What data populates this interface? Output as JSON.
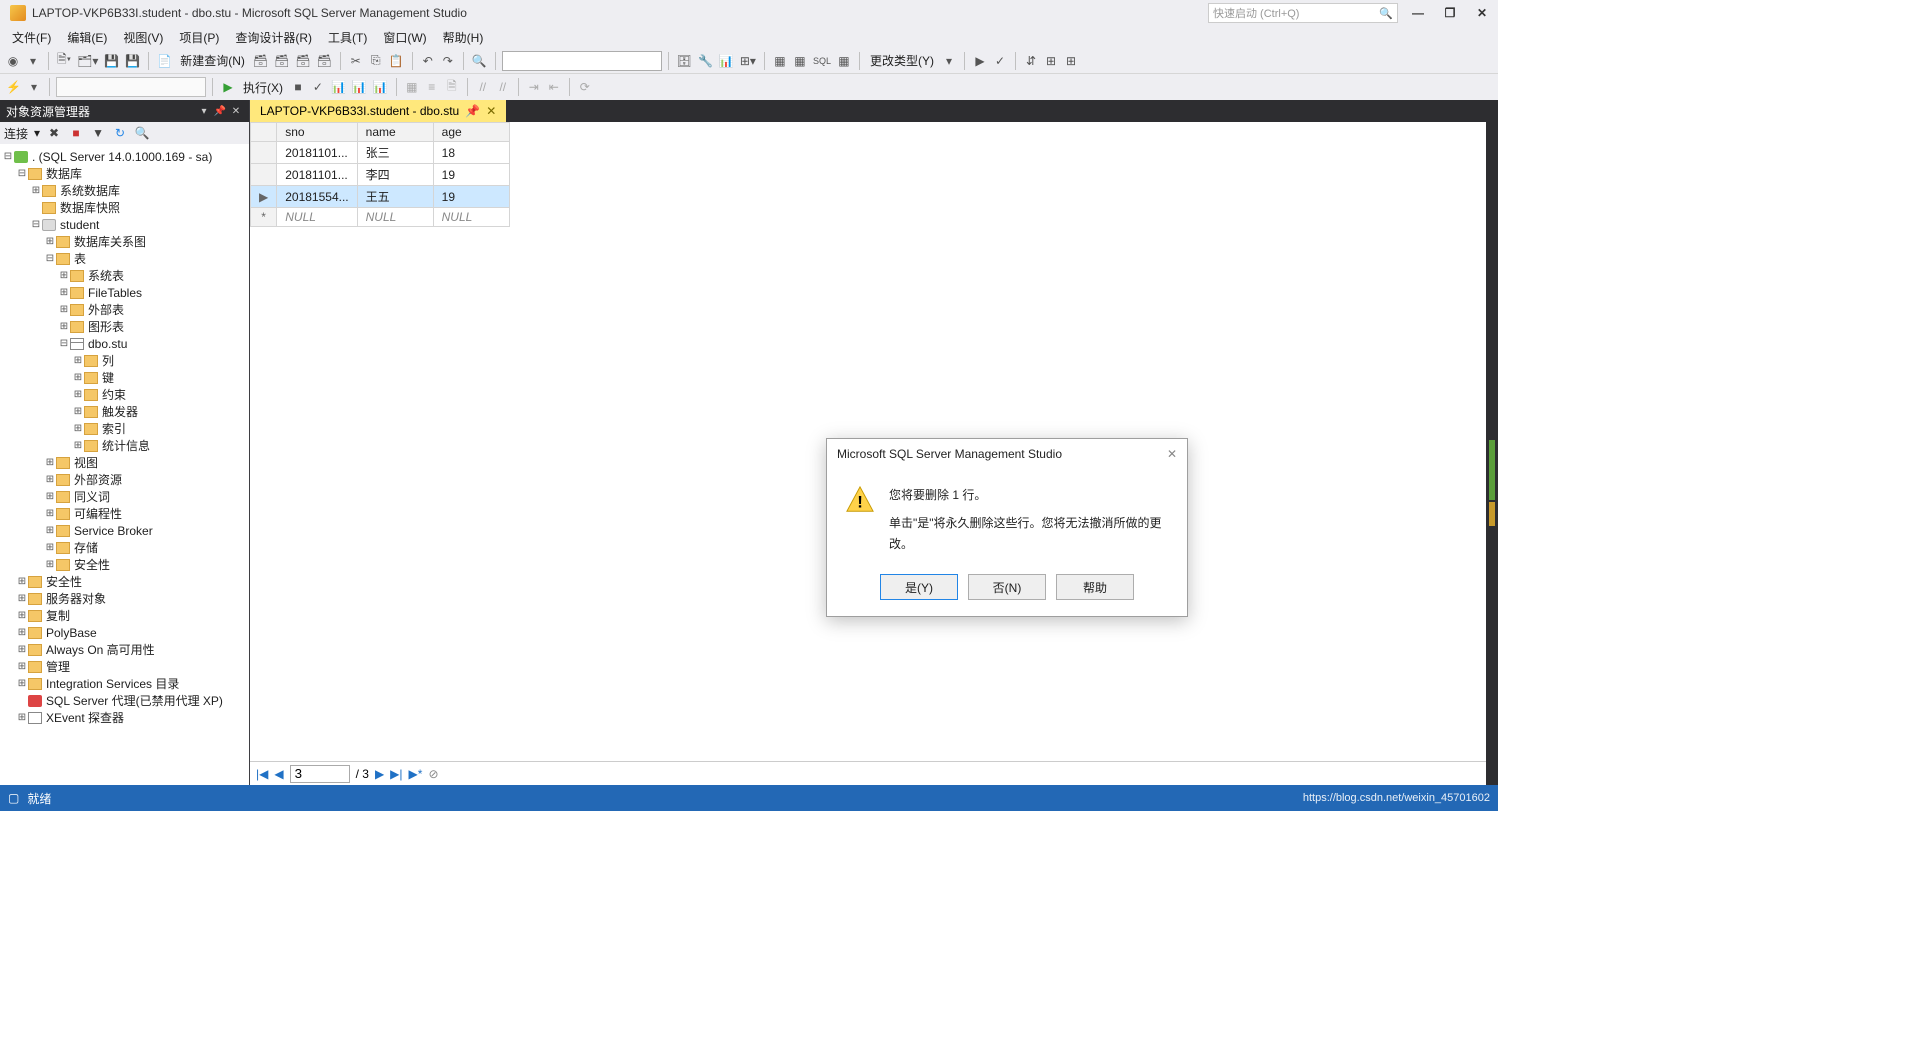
{
  "title": "LAPTOP-VKP6B33I.student - dbo.stu - Microsoft SQL Server Management Studio",
  "quicklaunch_placeholder": "快速启动 (Ctrl+Q)",
  "menus": [
    "文件(F)",
    "编辑(E)",
    "视图(V)",
    "项目(P)",
    "查询设计器(R)",
    "工具(T)",
    "窗口(W)",
    "帮助(H)"
  ],
  "toolbar": {
    "new_query": "新建查询(N)",
    "execute": "执行(X)",
    "change_type": "更改类型(Y)"
  },
  "object_explorer": {
    "title": "对象资源管理器",
    "connect": "连接",
    "root": ". (SQL Server 14.0.1000.169 - sa)",
    "nodes": {
      "databases": "数据库",
      "sys_db": "系统数据库",
      "db_snapshot": "数据库快照",
      "student": "student",
      "db_diagram": "数据库关系图",
      "tables": "表",
      "sys_tables": "系统表",
      "filetables": "FileTables",
      "external_tables": "外部表",
      "graph_tables": "图形表",
      "dbo_stu": "dbo.stu",
      "columns": "列",
      "keys": "键",
      "constraints": "约束",
      "triggers": "触发器",
      "indexes": "索引",
      "statistics": "统计信息",
      "views": "视图",
      "external_res": "外部资源",
      "synonyms": "同义词",
      "programmability": "可编程性",
      "service_broker": "Service Broker",
      "storage": "存储",
      "security_db": "安全性",
      "security": "安全性",
      "server_objects": "服务器对象",
      "replication": "复制",
      "polybase": "PolyBase",
      "always_on": "Always On 高可用性",
      "management": "管理",
      "integration": "Integration Services 目录",
      "sql_agent": "SQL Server 代理(已禁用代理 XP)",
      "xevent": "XEvent 探查器"
    }
  },
  "tab": {
    "label": "LAPTOP-VKP6B33I.student - dbo.stu"
  },
  "grid": {
    "headers": [
      "sno",
      "name",
      "age"
    ],
    "rows": [
      {
        "sno": "20181101...",
        "name": "张三",
        "age": "18"
      },
      {
        "sno": "20181101...",
        "name": "李四",
        "age": "19"
      },
      {
        "sno": "20181554...",
        "name": "王五",
        "age": "19",
        "selected": true
      },
      {
        "sno": "NULL",
        "name": "NULL",
        "age": "NULL",
        "new": true
      }
    ]
  },
  "nav": {
    "current": "3",
    "total": "/ 3"
  },
  "dialog": {
    "title": "Microsoft SQL Server Management Studio",
    "line1": "您将要删除 1 行。",
    "line2": "单击\"是\"将永久删除这些行。您将无法撤消所做的更改。",
    "yes": "是(Y)",
    "no": "否(N)",
    "help": "帮助"
  },
  "status": {
    "ready": "就绪",
    "watermark": "https://blog.csdn.net/weixin_45701602"
  }
}
